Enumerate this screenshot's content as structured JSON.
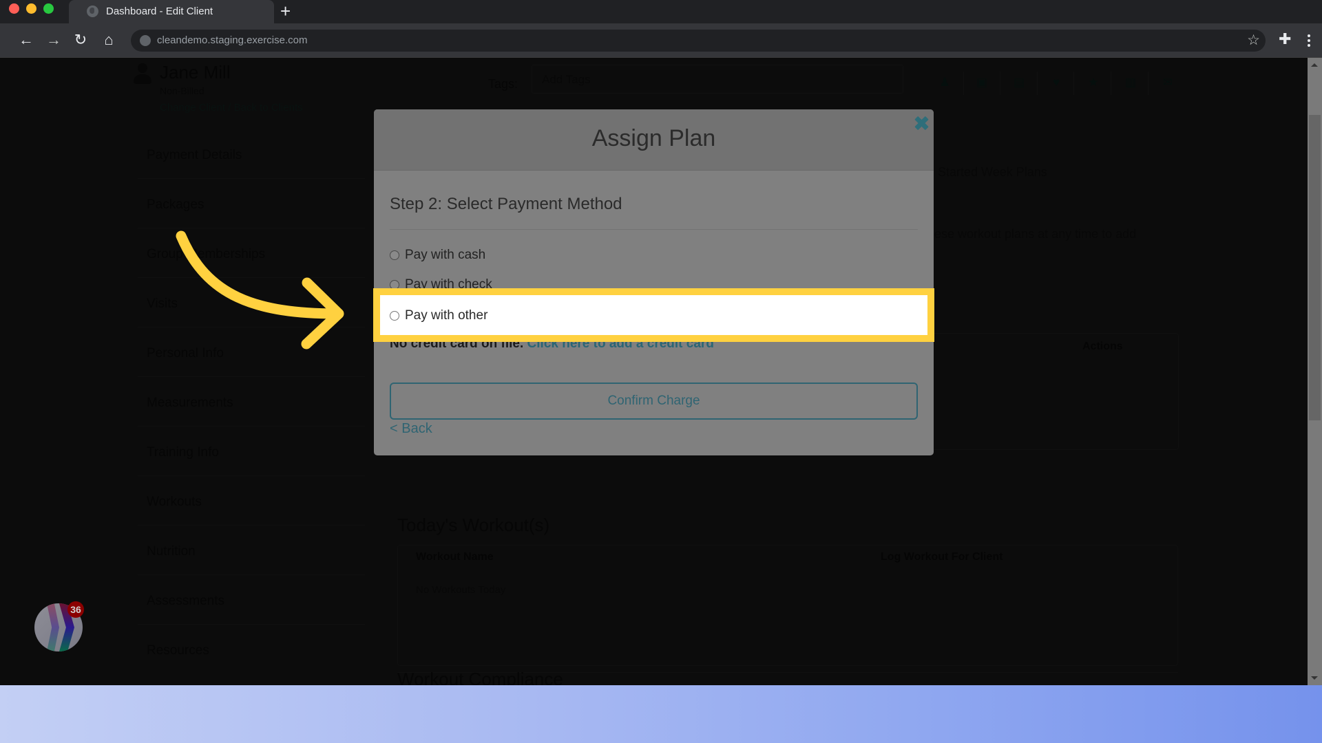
{
  "browser": {
    "tab_title": "Dashboard - Edit Client",
    "new_tab_symbol": "+",
    "url": "cleandemo.staging.exercise.com",
    "icons": {
      "back": "arrow-left-icon",
      "forward": "arrow-right-icon",
      "reload": "reload-icon",
      "home": "home-icon",
      "bookmark": "star-icon",
      "extensions": "puzzle-icon",
      "menu": "kebab-menu-icon"
    },
    "glyphs": {
      "back": "←",
      "forward": "→",
      "reload": "↻",
      "home": "⌂",
      "bookmark": "☆",
      "extensions": "✚"
    }
  },
  "client": {
    "name": "Jane Mill",
    "status": "Non-Billed",
    "change_client": "Change Client",
    "separator": "/",
    "back_to_clients": "Back to Clients"
  },
  "tags": {
    "label": "Tags:",
    "placeholder": "Add Tags"
  },
  "quick_icons": [
    "user-icon",
    "calendar-check-icon",
    "document-icon",
    "heart-pulse-icon",
    "star-icon",
    "chart-icon",
    "envelope-icon"
  ],
  "quick_glyphs": [
    "♟",
    "▣",
    "▤",
    "♥",
    "★",
    "▥",
    "✉"
  ],
  "sidebar": {
    "items": [
      {
        "label": "Payment Details"
      },
      {
        "label": "Packages"
      },
      {
        "label": "Group Memberships"
      },
      {
        "label": "Visits"
      },
      {
        "label": "Personal Info"
      },
      {
        "label": "Measurements"
      },
      {
        "label": "Training Info"
      },
      {
        "label": "Workouts"
      },
      {
        "label": "Nutrition"
      },
      {
        "label": "Assessments"
      },
      {
        "label": "Resources"
      }
    ]
  },
  "background": {
    "plans_heading_fragment": "Started Week Plans",
    "plans_para_fragment": "ese workout plans at any time to add",
    "plans_table_actions": "Actions",
    "todays_workouts": {
      "title": "Today's Workout(s)",
      "columns": [
        "Workout Name",
        "Log Workout For Client"
      ],
      "empty": "No Workouts Today"
    },
    "compliance_title": "Workout Compliance"
  },
  "chat_widget": {
    "badge_count": "36"
  },
  "modal": {
    "title": "Assign Plan",
    "close_icon": "close-icon",
    "step_title": "Step 2: Select Payment Method",
    "options": [
      {
        "label": "Pay with cash",
        "selected": false
      },
      {
        "label": "Pay with check",
        "selected": false
      },
      {
        "label": "Pay with other",
        "selected": false
      }
    ],
    "no_card_text": "No credit card on file.",
    "add_card_link": "Click here to add a credit card",
    "confirm_button": "Confirm Charge",
    "back_link": "< Back"
  },
  "annotation": {
    "highlight_target": "Pay with other",
    "highlight_color": "#ffd140"
  },
  "colors": {
    "accent_teal": "#2f6472",
    "highlight_yellow": "#ffd140",
    "badge_red": "#8b0000"
  }
}
